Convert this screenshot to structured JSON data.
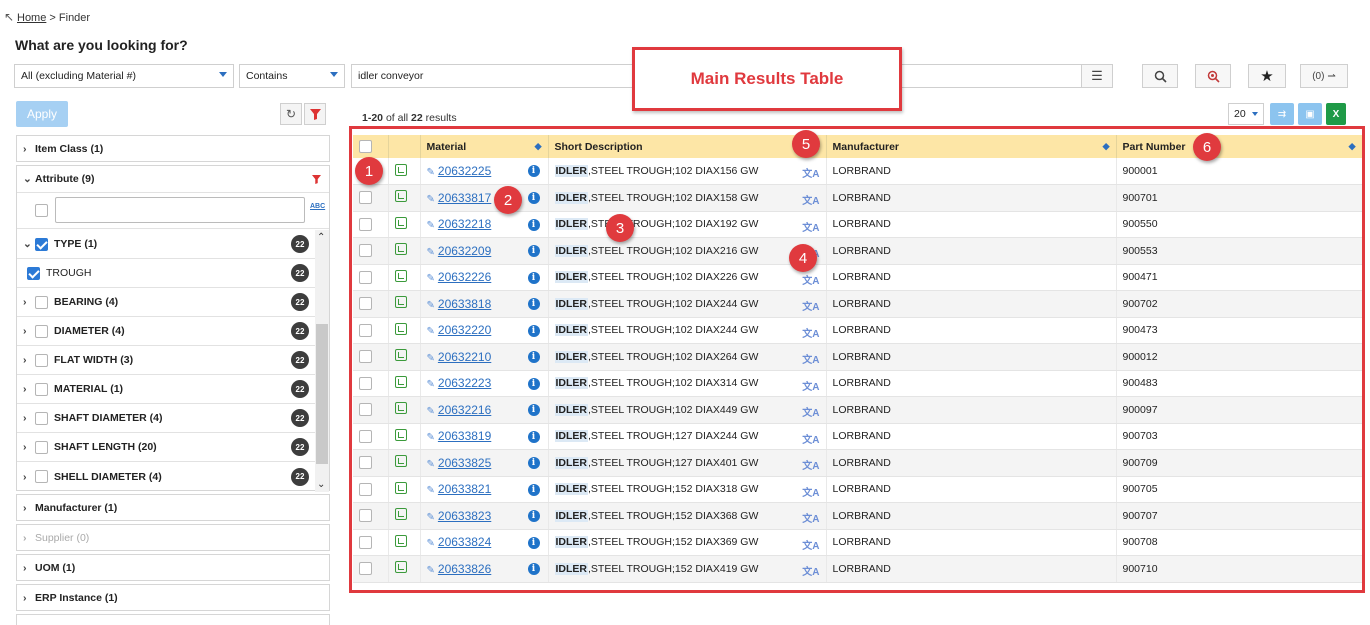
{
  "breadcrumb": {
    "home": "Home",
    "separator": ">",
    "current": "Finder"
  },
  "page_title": "What are you looking for?",
  "search": {
    "scope": "All (excluding Material #)",
    "operator": "Contains",
    "query": "idler conveyor",
    "cart_label": "(0)"
  },
  "sidebar": {
    "apply_label": "Apply",
    "facets_top": [
      {
        "label": "Item Class (1)"
      }
    ],
    "attribute_header": "Attribute (9)",
    "abc_label": "ABC",
    "attributes": [
      {
        "label": "TYPE (1)",
        "count": "22",
        "checked": true,
        "expanded": true
      },
      {
        "label": "TROUGH",
        "count": "22",
        "checked": true,
        "child": true
      },
      {
        "label": "BEARING (4)",
        "count": "22"
      },
      {
        "label": "DIAMETER (4)",
        "count": "22"
      },
      {
        "label": "FLAT WIDTH (3)",
        "count": "22"
      },
      {
        "label": "MATERIAL (1)",
        "count": "22"
      },
      {
        "label": "SHAFT DIAMETER (4)",
        "count": "22"
      },
      {
        "label": "SHAFT LENGTH (20)",
        "count": "22"
      },
      {
        "label": "SHELL DIAMETER (4)",
        "count": "22"
      }
    ],
    "facets_bottom": [
      {
        "label": "Manufacturer (1)",
        "disabled": false
      },
      {
        "label": "Supplier (0)",
        "disabled": true
      },
      {
        "label": "UOM (1)",
        "disabled": false
      },
      {
        "label": "ERP Instance (1)",
        "disabled": false
      }
    ]
  },
  "results": {
    "range": "1-20",
    "of_all": "of all",
    "total": "22",
    "suffix": "results",
    "page_size": "20"
  },
  "table": {
    "headers": {
      "material": "Material",
      "short_description": "Short Description",
      "manufacturer": "Manufacturer",
      "part_number": "Part Number"
    },
    "rows": [
      {
        "material": "20632225",
        "desc_kw": "IDLER",
        "desc": ",STEEL TROUGH;102 DIAX156 GW",
        "manufacturer": "LORBRAND",
        "part": "900001"
      },
      {
        "material": "20633817",
        "desc_kw": "IDLER",
        "desc": ",STEEL TROUGH;102 DIAX158 GW",
        "manufacturer": "LORBRAND",
        "part": "900701"
      },
      {
        "material": "20632218",
        "desc_kw": "IDLER",
        "desc": ",STEEL TROUGH;102 DIAX192 GW",
        "manufacturer": "LORBRAND",
        "part": "900550"
      },
      {
        "material": "20632209",
        "desc_kw": "IDLER",
        "desc": ",STEEL TROUGH;102 DIAX216 GW",
        "manufacturer": "LORBRAND",
        "part": "900553"
      },
      {
        "material": "20632226",
        "desc_kw": "IDLER",
        "desc": ",STEEL TROUGH;102 DIAX226 GW",
        "manufacturer": "LORBRAND",
        "part": "900471"
      },
      {
        "material": "20633818",
        "desc_kw": "IDLER",
        "desc": ",STEEL TROUGH;102 DIAX244 GW",
        "manufacturer": "LORBRAND",
        "part": "900702"
      },
      {
        "material": "20632220",
        "desc_kw": "IDLER",
        "desc": ",STEEL TROUGH;102 DIAX244 GW",
        "manufacturer": "LORBRAND",
        "part": "900473"
      },
      {
        "material": "20632210",
        "desc_kw": "IDLER",
        "desc": ",STEEL TROUGH;102 DIAX264 GW",
        "manufacturer": "LORBRAND",
        "part": "900012"
      },
      {
        "material": "20632223",
        "desc_kw": "IDLER",
        "desc": ",STEEL TROUGH;102 DIAX314 GW",
        "manufacturer": "LORBRAND",
        "part": "900483"
      },
      {
        "material": "20632216",
        "desc_kw": "IDLER",
        "desc": ",STEEL TROUGH;102 DIAX449 GW",
        "manufacturer": "LORBRAND",
        "part": "900097"
      },
      {
        "material": "20633819",
        "desc_kw": "IDLER",
        "desc": ",STEEL TROUGH;127 DIAX244 GW",
        "manufacturer": "LORBRAND",
        "part": "900703"
      },
      {
        "material": "20633825",
        "desc_kw": "IDLER",
        "desc": ",STEEL TROUGH;127 DIAX401 GW",
        "manufacturer": "LORBRAND",
        "part": "900709"
      },
      {
        "material": "20633821",
        "desc_kw": "IDLER",
        "desc": ",STEEL TROUGH;152 DIAX318 GW",
        "manufacturer": "LORBRAND",
        "part": "900705"
      },
      {
        "material": "20633823",
        "desc_kw": "IDLER",
        "desc": ",STEEL TROUGH;152 DIAX368 GW",
        "manufacturer": "LORBRAND",
        "part": "900707"
      },
      {
        "material": "20633824",
        "desc_kw": "IDLER",
        "desc": ",STEEL TROUGH;152 DIAX369 GW",
        "manufacturer": "LORBRAND",
        "part": "900708"
      },
      {
        "material": "20633826",
        "desc_kw": "IDLER",
        "desc": ",STEEL TROUGH;152 DIAX419 GW",
        "manufacturer": "LORBRAND",
        "part": "900710"
      }
    ]
  },
  "annotations": {
    "label": "Main Results Table",
    "markers": [
      "1",
      "2",
      "3",
      "4",
      "5",
      "6"
    ],
    "color": "#e0393e"
  }
}
